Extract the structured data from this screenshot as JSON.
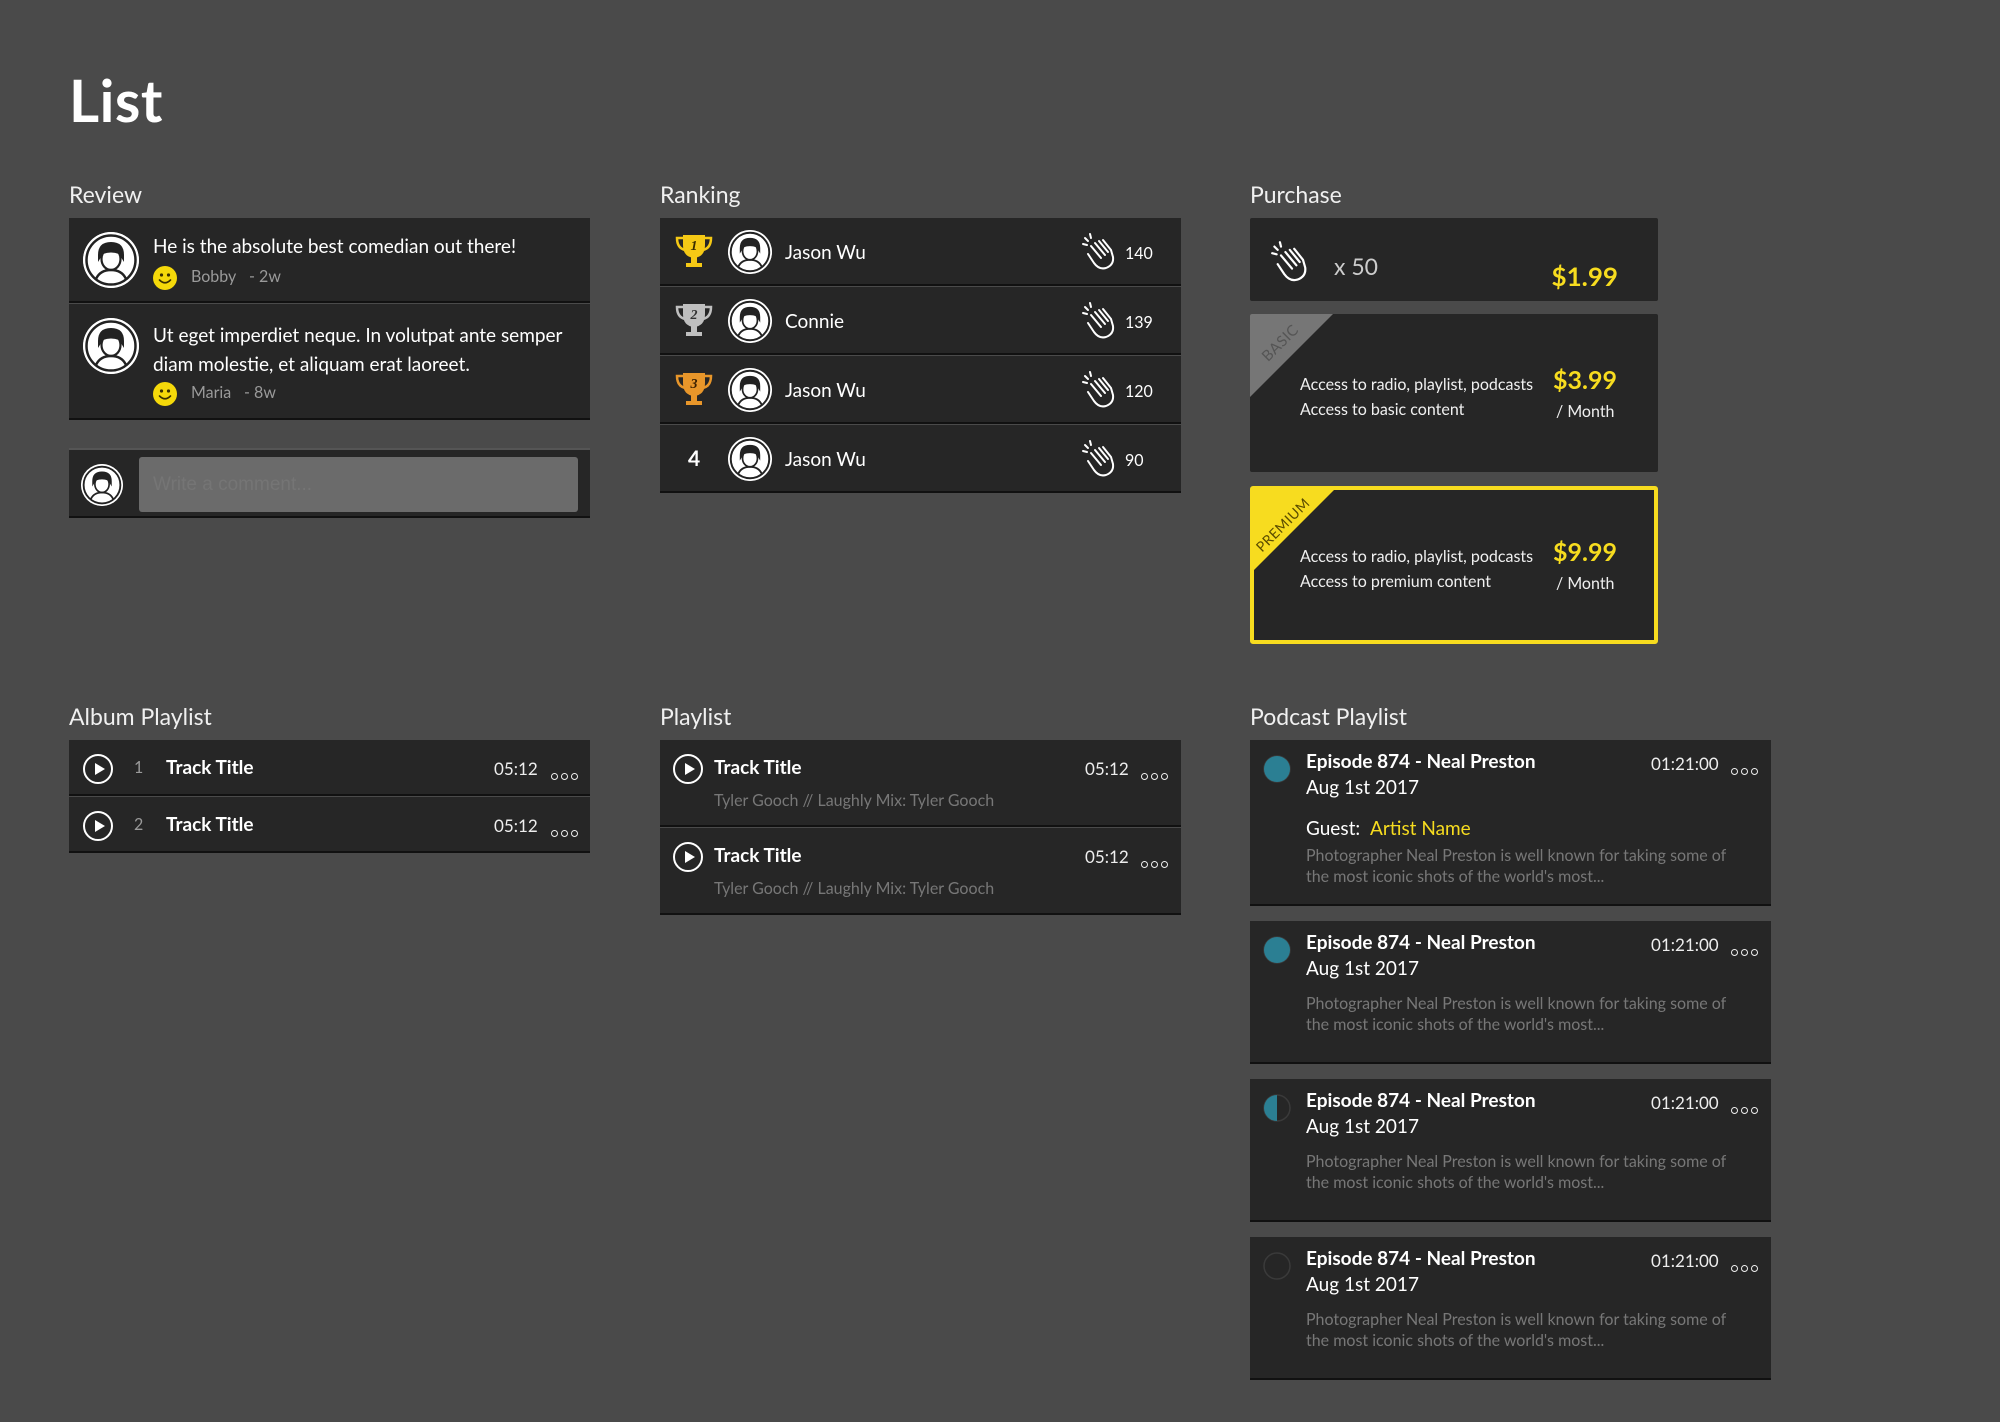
{
  "page_title": "List",
  "review": {
    "title": "Review",
    "items": [
      {
        "text": "He is the absolute best comedian out there!",
        "author": "Bobby",
        "time": "- 2w"
      },
      {
        "text_line1": "Ut eget imperdiet neque. In volutpat ante semper",
        "text_line2": "diam molestie, et aliquam erat laoreet.",
        "author": "Maria",
        "time": "- 8w"
      }
    ],
    "comment_placeholder": "Write a comment..."
  },
  "ranking": {
    "title": "Ranking",
    "rows": [
      {
        "rank": "1",
        "name": "Jason Wu",
        "claps": "140",
        "trophy_color": "#f5c915"
      },
      {
        "rank": "2",
        "name": "Connie",
        "claps": "139",
        "trophy_color": "#bfbfbf"
      },
      {
        "rank": "3",
        "name": "Jason Wu",
        "claps": "120",
        "trophy_color": "#e8962a"
      },
      {
        "rank": "4",
        "name": "Jason Wu",
        "claps": "90"
      }
    ]
  },
  "purchase": {
    "title": "Purchase",
    "claps": {
      "quantity": "x 50",
      "price": "$1.99"
    },
    "basic": {
      "ribbon": "BASIC",
      "line1": "Access to radio, playlist, podcasts",
      "line2": "Access to basic content",
      "price": "$3.99",
      "period": "/ Month"
    },
    "premium": {
      "ribbon": "PREMIUM",
      "line1": "Access to radio, playlist, podcasts",
      "line2": "Access to premium content",
      "price": "$9.99",
      "period": "/ Month"
    }
  },
  "album_playlist": {
    "title": "Album Playlist",
    "tracks": [
      {
        "number": "1",
        "title": "Track Title",
        "duration": "05:12"
      },
      {
        "number": "2",
        "title": "Track Title",
        "duration": "05:12"
      }
    ]
  },
  "playlist": {
    "title": "Playlist",
    "tracks": [
      {
        "title": "Track Title",
        "subtitle": "Tyler Gooch // Laughly Mix: Tyler Gooch",
        "duration": "05:12"
      },
      {
        "title": "Track Title",
        "subtitle": "Tyler Gooch // Laughly Mix: Tyler Gooch",
        "duration": "05:12"
      }
    ]
  },
  "podcast_playlist": {
    "title": "Podcast Playlist",
    "episodes": [
      {
        "title": "Episode 874 - Neal Preston",
        "date": "Aug 1st 2017",
        "duration": "01:21:00",
        "guest_label": "Guest:",
        "guest_name": "Artist Name",
        "desc1": "Photographer Neal Preston is well known for taking some of",
        "desc2": "the most iconic shots of the world's most...",
        "progress": 1.0
      },
      {
        "title": "Episode 874 - Neal Preston",
        "date": "Aug 1st 2017",
        "duration": "01:21:00",
        "desc1": "Photographer Neal Preston is well known for taking some of",
        "desc2": "the most iconic shots of the world's most...",
        "progress": 1.0
      },
      {
        "title": "Episode 874 - Neal Preston",
        "date": "Aug 1st 2017",
        "duration": "01:21:00",
        "desc1": "Photographer Neal Preston is well known for taking some of",
        "desc2": "the most iconic shots of the world's most...",
        "progress": 0.5
      },
      {
        "title": "Episode 874 - Neal Preston",
        "date": "Aug 1st 2017",
        "duration": "01:21:00",
        "desc1": "Photographer Neal Preston is well known for taking some of",
        "desc2": "the most iconic shots of the world's most...",
        "progress": 0.0
      }
    ]
  },
  "colors": {
    "background": "#4a4a4a",
    "card": "#262626",
    "accent_yellow": "#f7dc1f",
    "progress_teal": "#2b7f93"
  },
  "icons": [
    "avatar-icon",
    "smiley-icon",
    "trophy-icon",
    "clap-icon",
    "play-icon",
    "more-dots-icon",
    "progress-circle-icon"
  ]
}
